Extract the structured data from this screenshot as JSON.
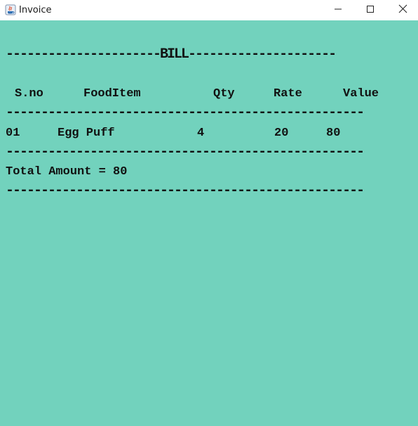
{
  "window": {
    "title": "Invoice",
    "icon": "java-coffee-cup-icon",
    "controls": {
      "minimize": "minimize-icon",
      "maximize": "maximize-icon",
      "close": "close-icon"
    }
  },
  "bill": {
    "header_line": "----------------------BILL---------------------",
    "separator": "---------------------------------------------------",
    "columns": [
      "S.no",
      "FoodItem",
      "Qty",
      "Rate",
      "Value"
    ],
    "rows": [
      {
        "sno": "01",
        "item": "Egg Puff",
        "qty": "4",
        "rate": "20",
        "value": "80"
      }
    ],
    "total_label": "Total Amount = 80"
  },
  "colors": {
    "background": "#72d2bd",
    "titlebar": "#ffffff",
    "text": "#111111"
  }
}
